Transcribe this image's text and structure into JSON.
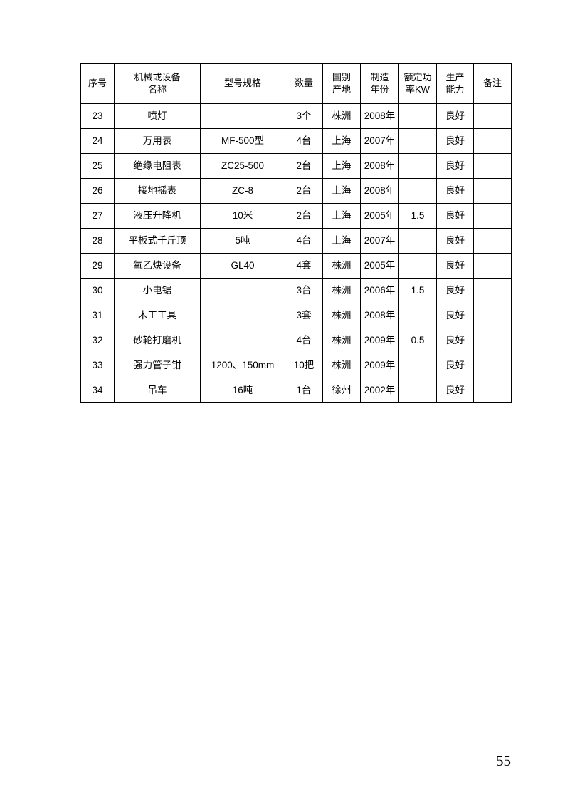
{
  "document": {
    "page_number": "55"
  },
  "table": {
    "columns": [
      {
        "key": "seq",
        "label": "序号",
        "label_line1": "序号",
        "label_line2": ""
      },
      {
        "key": "name",
        "label": "机械或设备名称",
        "label_line1": "机械或设备",
        "label_line2": "名称"
      },
      {
        "key": "model",
        "label": "型号规格",
        "label_line1": "型号规格",
        "label_line2": ""
      },
      {
        "key": "qty",
        "label": "数量",
        "label_line1": "数量",
        "label_line2": ""
      },
      {
        "key": "origin",
        "label": "国别产地",
        "label_line1": "国别",
        "label_line2": "产地"
      },
      {
        "key": "year",
        "label": "制造年份",
        "label_line1": "制造",
        "label_line2": "年份"
      },
      {
        "key": "power",
        "label": "额定功率KW",
        "label_line1": "额定功",
        "label_line2": "率KW"
      },
      {
        "key": "cap",
        "label": "生产能力",
        "label_line1": "生产",
        "label_line2": "能力"
      },
      {
        "key": "remark",
        "label": "备注",
        "label_line1": "备注",
        "label_line2": ""
      }
    ],
    "rows": [
      {
        "seq": "23",
        "name": "喷灯",
        "model": "",
        "qty": "3个",
        "origin": "株洲",
        "year": "2008年",
        "power": "",
        "cap": "良好",
        "remark": ""
      },
      {
        "seq": "24",
        "name": "万用表",
        "model": "MF-500型",
        "qty": "4台",
        "origin": "上海",
        "year": "2007年",
        "power": "",
        "cap": "良好",
        "remark": ""
      },
      {
        "seq": "25",
        "name": "绝缘电阻表",
        "model": "ZC25-500",
        "qty": "2台",
        "origin": "上海",
        "year": "2008年",
        "power": "",
        "cap": "良好",
        "remark": ""
      },
      {
        "seq": "26",
        "name": "接地摇表",
        "model": "ZC-8",
        "qty": "2台",
        "origin": "上海",
        "year": "2008年",
        "power": "",
        "cap": "良好",
        "remark": ""
      },
      {
        "seq": "27",
        "name": "液压升降机",
        "model": "10米",
        "qty": "2台",
        "origin": "上海",
        "year": "2005年",
        "power": "1.5",
        "cap": "良好",
        "remark": ""
      },
      {
        "seq": "28",
        "name": "平板式千斤顶",
        "model": "5吨",
        "qty": "4台",
        "origin": "上海",
        "year": "2007年",
        "power": "",
        "cap": "良好",
        "remark": ""
      },
      {
        "seq": "29",
        "name": "氧乙炔设备",
        "model": "GL40",
        "qty": "4套",
        "origin": "株洲",
        "year": "2005年",
        "power": "",
        "cap": "良好",
        "remark": ""
      },
      {
        "seq": "30",
        "name": "小电锯",
        "model": "",
        "qty": "3台",
        "origin": "株洲",
        "year": "2006年",
        "power": "1.5",
        "cap": "良好",
        "remark": ""
      },
      {
        "seq": "31",
        "name": "木工工具",
        "model": "",
        "qty": "3套",
        "origin": "株洲",
        "year": "2008年",
        "power": "",
        "cap": "良好",
        "remark": ""
      },
      {
        "seq": "32",
        "name": "砂轮打磨机",
        "model": "",
        "qty": "4台",
        "origin": "株洲",
        "year": "2009年",
        "power": "0.5",
        "cap": "良好",
        "remark": ""
      },
      {
        "seq": "33",
        "name": "强力管子钳",
        "model": "1200、150mm",
        "qty": "10把",
        "origin": "株洲",
        "year": "2009年",
        "power": "",
        "cap": "良好",
        "remark": ""
      },
      {
        "seq": "34",
        "name": "吊车",
        "model": "16吨",
        "qty": "1台",
        "origin": "徐州",
        "year": "2002年",
        "power": "",
        "cap": "良好",
        "remark": ""
      }
    ]
  }
}
